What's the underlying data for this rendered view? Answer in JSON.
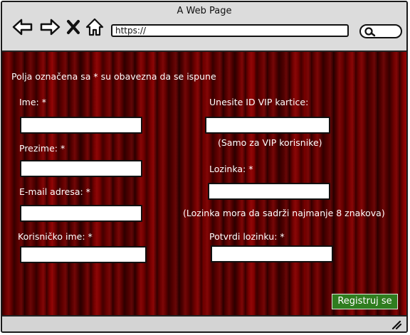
{
  "window": {
    "title": "A Web Page",
    "url": "https://"
  },
  "icons": {
    "back": "arrow-left-icon",
    "forward": "arrow-right-icon",
    "stop": "close-icon",
    "home": "home-icon",
    "search": "search-icon",
    "resize": "resize-grip-icon"
  },
  "form": {
    "notice": "Polja označena sa * su obavezna da se ispune",
    "left": {
      "ime_label": "Ime: *",
      "prezime_label": "Prezime:  *",
      "email_label": "E-mail adresa: *",
      "username_label": "Korisničko ime: *"
    },
    "right": {
      "vip_label": "Unesite ID VIP kartice:",
      "vip_hint": "(Samo za VIP korisnike)",
      "password_label": "Lozinka: *",
      "password_hint": "(Lozinka mora da sadrži najmanje 8 znakova)",
      "confirm_label": "Potvrdi lozinku: *"
    },
    "submit_label": "Registruj se"
  },
  "colors": {
    "curtain": "#6d0000",
    "submit_button": "#2f7d1f"
  }
}
